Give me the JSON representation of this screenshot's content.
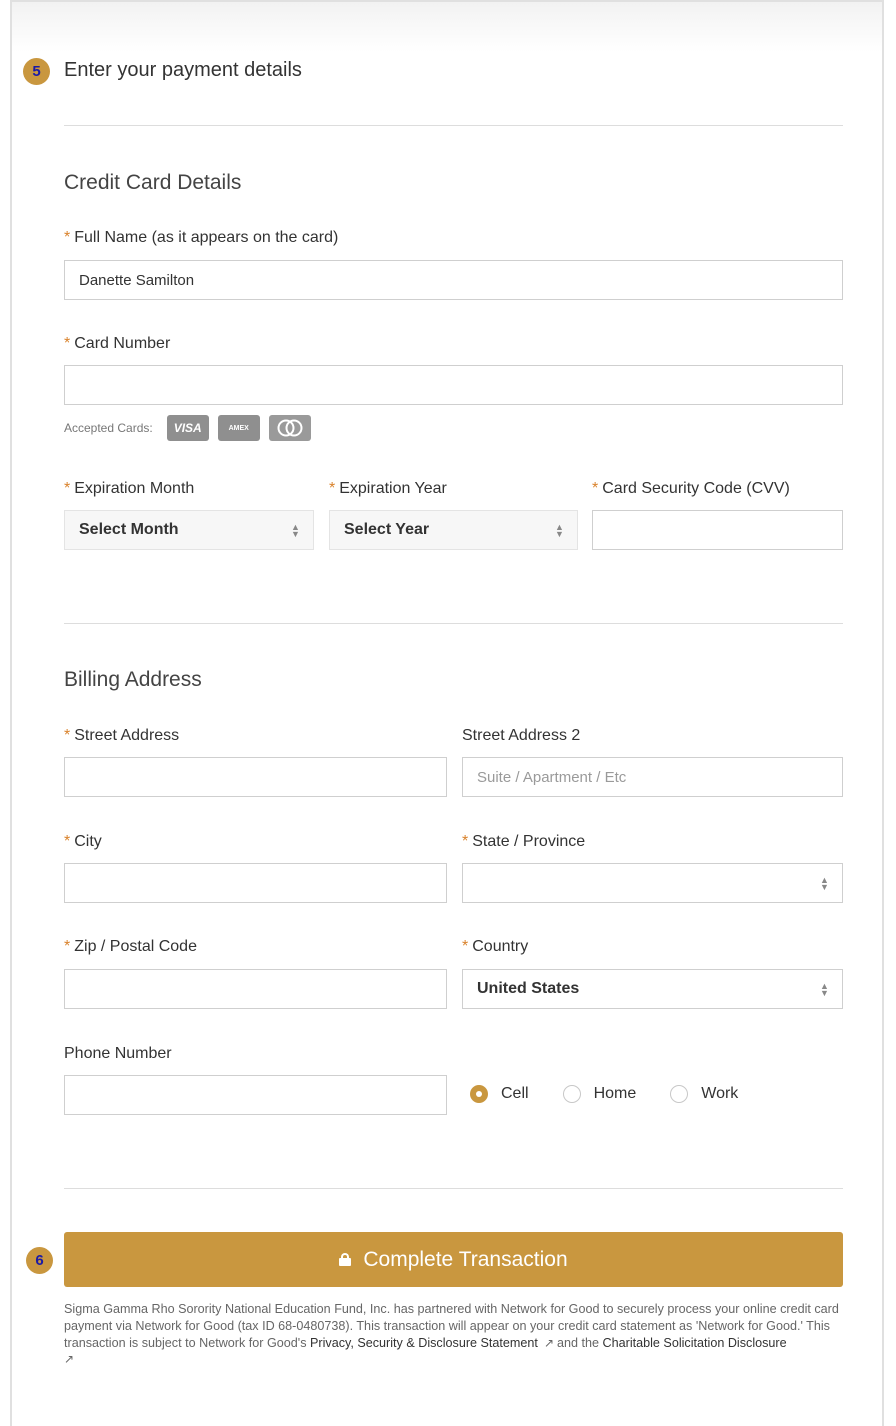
{
  "steps": {
    "payment": "5",
    "submit": "6"
  },
  "page_title": "Enter your payment details",
  "credit_card": {
    "heading": "Credit Card Details",
    "full_name_label": "Full Name (as it appears on the card)",
    "full_name_value": "Danette Samilton",
    "card_number_label": "Card Number",
    "card_number_value": "",
    "accepted_cards_label": "Accepted Cards:",
    "cards": {
      "visa": "VISA",
      "amex": "AMEX",
      "mastercard": "MC"
    },
    "exp_month_label": "Expiration Month",
    "exp_month_value": "Select Month",
    "exp_year_label": "Expiration Year",
    "exp_year_value": "Select Year",
    "cvv_label": "Card Security Code (CVV)"
  },
  "billing": {
    "heading": "Billing Address",
    "street_label": "Street Address",
    "street2_label": "Street Address 2",
    "street2_placeholder": "Suite / Apartment / Etc",
    "city_label": "City",
    "state_label": "State / Province",
    "zip_label": "Zip / Postal Code",
    "country_label": "Country",
    "country_value": "United States",
    "phone_label": "Phone Number",
    "phone_types": [
      {
        "label": "Cell",
        "checked": true
      },
      {
        "label": "Home",
        "checked": false
      },
      {
        "label": "Work",
        "checked": false
      }
    ]
  },
  "required_marker": "*",
  "submit_label": "Complete Transaction",
  "disclaimer": {
    "text_1": "Sigma Gamma Rho Sorority National Education Fund, Inc. has partnered with Network for Good to securely process your online credit card payment via Network for Good (tax ID 68-0480738). This transaction will appear on your credit card statement as 'Network for Good.' This transaction is subject to Network for Good's ",
    "privacy_link": "Privacy, Security & Disclosure Statement",
    "text_2": "and the ",
    "charitable_link": "Charitable Solicitation Disclosure"
  },
  "colors": {
    "accent": "#c9973f",
    "required": "#d9822b",
    "badge_text": "#1a1aa6"
  }
}
